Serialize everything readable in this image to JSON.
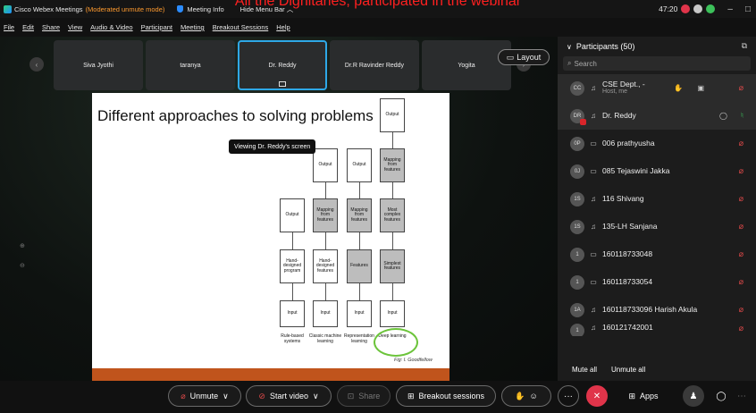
{
  "caption": "All the Dignitaries, participated in the webinar",
  "titlebar": {
    "app_title": "Cisco Webex Meetings",
    "mode": "(Moderated unmute mode)",
    "meeting_info": "Meeting Info",
    "hide_menu": "Hide Menu Bar ︿",
    "time": "47:20",
    "minimize": "–",
    "restore": "□"
  },
  "menu": [
    "File",
    "Edit",
    "Share",
    "View",
    "Audio & Video",
    "Participant",
    "Meeting",
    "Breakout Sessions",
    "Help"
  ],
  "thumbnails": [
    {
      "name": "Siva Jyothi"
    },
    {
      "name": "taranya"
    },
    {
      "name": "Dr. Reddy"
    },
    {
      "name": "Dr.R Ravinder Reddy"
    },
    {
      "name": "Yogita"
    }
  ],
  "layout_label": "Layout",
  "viewing_tip": "Viewing Dr. Reddy's screen",
  "slide": {
    "title": "Different approaches to solving problems",
    "col1": {
      "input": "Input",
      "program": "Hand-designed program",
      "output": "Output",
      "caption": "Rule-based systems"
    },
    "col2": {
      "input": "Input",
      "features": "Hand-designed features",
      "mapping": "Mapping from features",
      "output": "Output",
      "caption": "Classic machine learning"
    },
    "col3": {
      "input": "Input",
      "features": "Features",
      "mapping": "Mapping from features",
      "output": "Output",
      "caption": "Representation learning"
    },
    "col4": {
      "input": "Input",
      "simplest": "Simplest features",
      "complex": "Most complex features",
      "mapping": "Mapping from features",
      "output": "Output",
      "caption": "Deep learning"
    },
    "fig": "Fig: I. Goodfellow"
  },
  "panel": {
    "title": "Participants (50)",
    "search_placeholder": "Search",
    "participants": [
      {
        "initials": "CC",
        "name": "CSE Dept., -",
        "sub": "Host, me",
        "mic": "muted",
        "device": "headset"
      },
      {
        "initials": "DR",
        "name": "Dr. Reddy",
        "sub": "",
        "mic": "on",
        "device": "headset"
      },
      {
        "initials": "0P",
        "name": "006 prathyusha",
        "sub": "",
        "mic": "muted",
        "device": "phone"
      },
      {
        "initials": "0J",
        "name": "085 Tejaswini Jakka",
        "sub": "",
        "mic": "muted",
        "device": "phone"
      },
      {
        "initials": "1S",
        "name": "116 Shivang",
        "sub": "",
        "mic": "muted",
        "device": "headset"
      },
      {
        "initials": "1S",
        "name": "135-LH Sanjana",
        "sub": "",
        "mic": "muted",
        "device": "headset"
      },
      {
        "initials": "1",
        "name": "160118733048",
        "sub": "",
        "mic": "muted",
        "device": "phone"
      },
      {
        "initials": "1",
        "name": "160118733054",
        "sub": "",
        "mic": "muted",
        "device": "phone"
      },
      {
        "initials": "1A",
        "name": "160118733096 Harish Akula",
        "sub": "",
        "mic": "muted",
        "device": "headset"
      },
      {
        "initials": "1",
        "name": "160121742001",
        "sub": "",
        "mic": "muted",
        "device": "headset"
      }
    ],
    "mute_all": "Mute all",
    "unmute_all": "Unmute all"
  },
  "bottombar": {
    "unmute": "Unmute",
    "start_video": "Start video",
    "share": "Share",
    "breakout": "Breakout sessions",
    "apps": "Apps",
    "more": "···"
  },
  "colors": {
    "accent": "#2ea8e6",
    "danger": "#e14a4a",
    "ok": "#3cc15a",
    "slide_bar": "#c0541c"
  }
}
